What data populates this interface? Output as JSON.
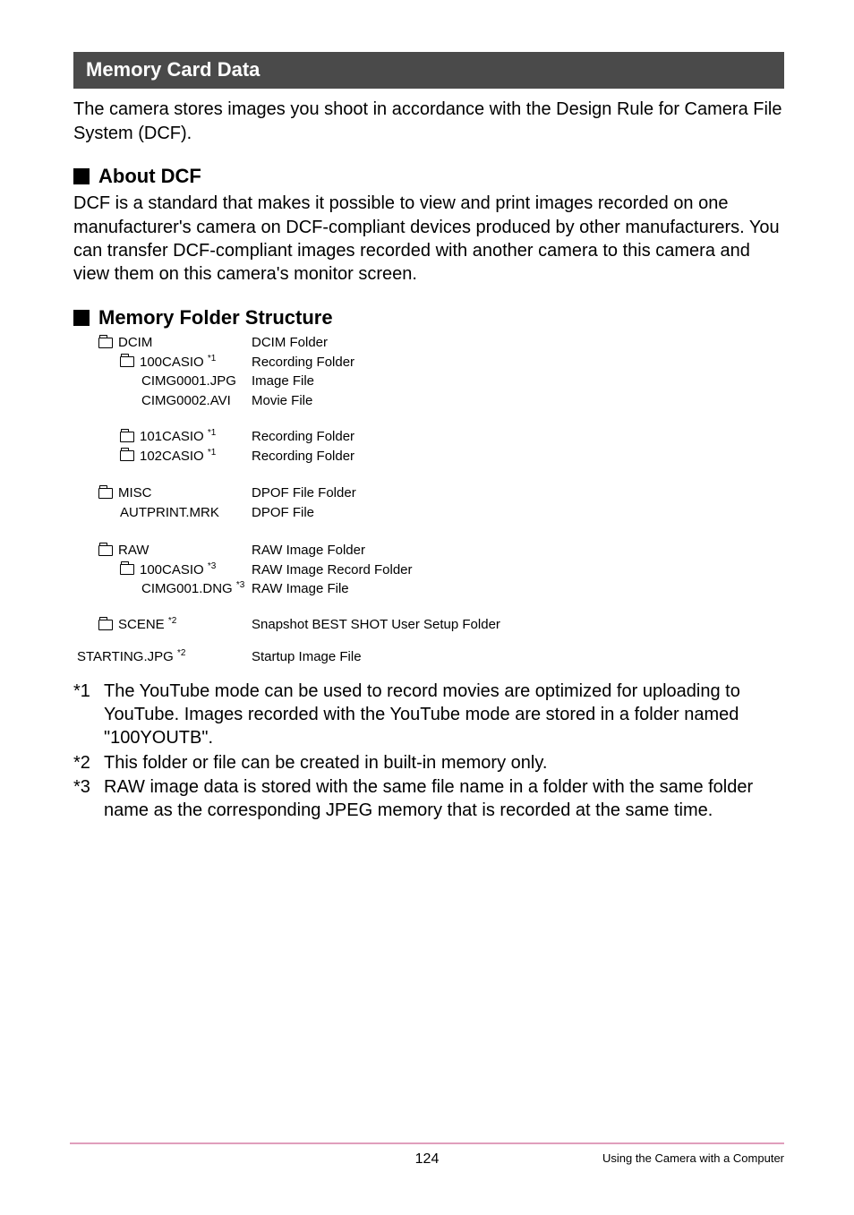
{
  "header": {
    "title": "Memory Card Data"
  },
  "intro": "The camera stores images you shoot in accordance with the Design Rule for Camera File System (DCF).",
  "sections": {
    "about_dcf": {
      "heading": "About DCF",
      "text": "DCF is a standard that makes it possible to view and print images recorded on one manufacturer's camera on DCF-compliant devices produced by other manufacturers. You can transfer DCF-compliant images recorded with another camera to this camera and view them on this camera's monitor screen."
    },
    "folder_structure": {
      "heading": "Memory Folder Structure"
    }
  },
  "tree": {
    "dcim": {
      "name": "DCIM",
      "desc": "DCIM Folder"
    },
    "f100": {
      "name": "100CASIO",
      "sup": "*1",
      "desc": "Recording Folder"
    },
    "img1": {
      "name": "CIMG0001.JPG",
      "desc": "Image File"
    },
    "img2": {
      "name": "CIMG0002.AVI",
      "desc": "Movie File"
    },
    "f101": {
      "name": "101CASIO",
      "sup": "*1",
      "desc": "Recording Folder"
    },
    "f102": {
      "name": "102CASIO",
      "sup": "*1",
      "desc": "Recording Folder"
    },
    "misc": {
      "name": "MISC",
      "desc": "DPOF File Folder"
    },
    "autp": {
      "name": "AUTPRINT.MRK",
      "desc": "DPOF File"
    },
    "raw": {
      "name": "RAW",
      "desc": "RAW Image Folder"
    },
    "r100": {
      "name": "100CASIO",
      "sup": "*3",
      "desc": "RAW Image Record Folder"
    },
    "rimg": {
      "name": "CIMG001.DNG",
      "sup": "*3",
      "desc": "RAW Image File"
    },
    "scene": {
      "name": "SCENE",
      "sup": "*2",
      "desc": "Snapshot BEST SHOT User Setup Folder"
    },
    "starting": {
      "name": "STARTING.JPG",
      "sup": "*2",
      "desc": "Startup Image File"
    }
  },
  "notes": {
    "n1": {
      "mark": "*1",
      "text": "The YouTube mode can be used to record movies are optimized for uploading to YouTube. Images recorded with the YouTube mode are stored in a folder named \"100YOUTB\"."
    },
    "n2": {
      "mark": "*2",
      "text": "This folder or file can be created in built-in memory only."
    },
    "n3": {
      "mark": "*3",
      "text": "RAW image data is stored with the same file name in a folder with the same folder name as the corresponding JPEG memory that is recorded at the same time."
    }
  },
  "footer": {
    "page": "124",
    "right": "Using the Camera with a Computer"
  }
}
